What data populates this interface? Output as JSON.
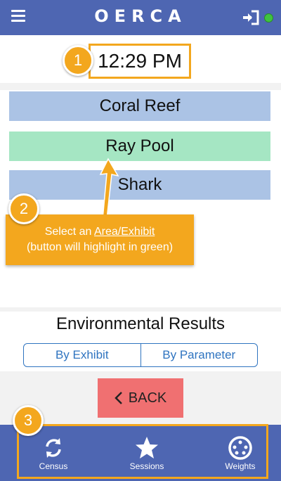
{
  "header": {
    "logo": "OERCA",
    "status_color": "#3fc33f"
  },
  "time": "12:29 PM",
  "badges": [
    "1",
    "2",
    "3"
  ],
  "areas": [
    {
      "label": "Coral Reef",
      "color": "#abc3e5"
    },
    {
      "label": "Ray Pool",
      "color": "#a5e6c3"
    },
    {
      "label": "Shark",
      "color": "#abc3e5"
    }
  ],
  "tooltip": {
    "prefix": "Select an ",
    "link": "Area/Exhibit",
    "line2": "(button will highlight in green)"
  },
  "environmental": {
    "title": "Environmental Results",
    "by_exhibit": "By Exhibit",
    "by_parameter": "By Parameter"
  },
  "back_label": "BACK",
  "nav": [
    {
      "label": "Census",
      "icon": "refresh-icon"
    },
    {
      "label": "Sessions",
      "icon": "star-icon"
    },
    {
      "label": "Weights",
      "icon": "scale-icon"
    }
  ],
  "colors": {
    "primary": "#4e66b2",
    "accent": "#f3a71e",
    "back": "#f07071"
  }
}
